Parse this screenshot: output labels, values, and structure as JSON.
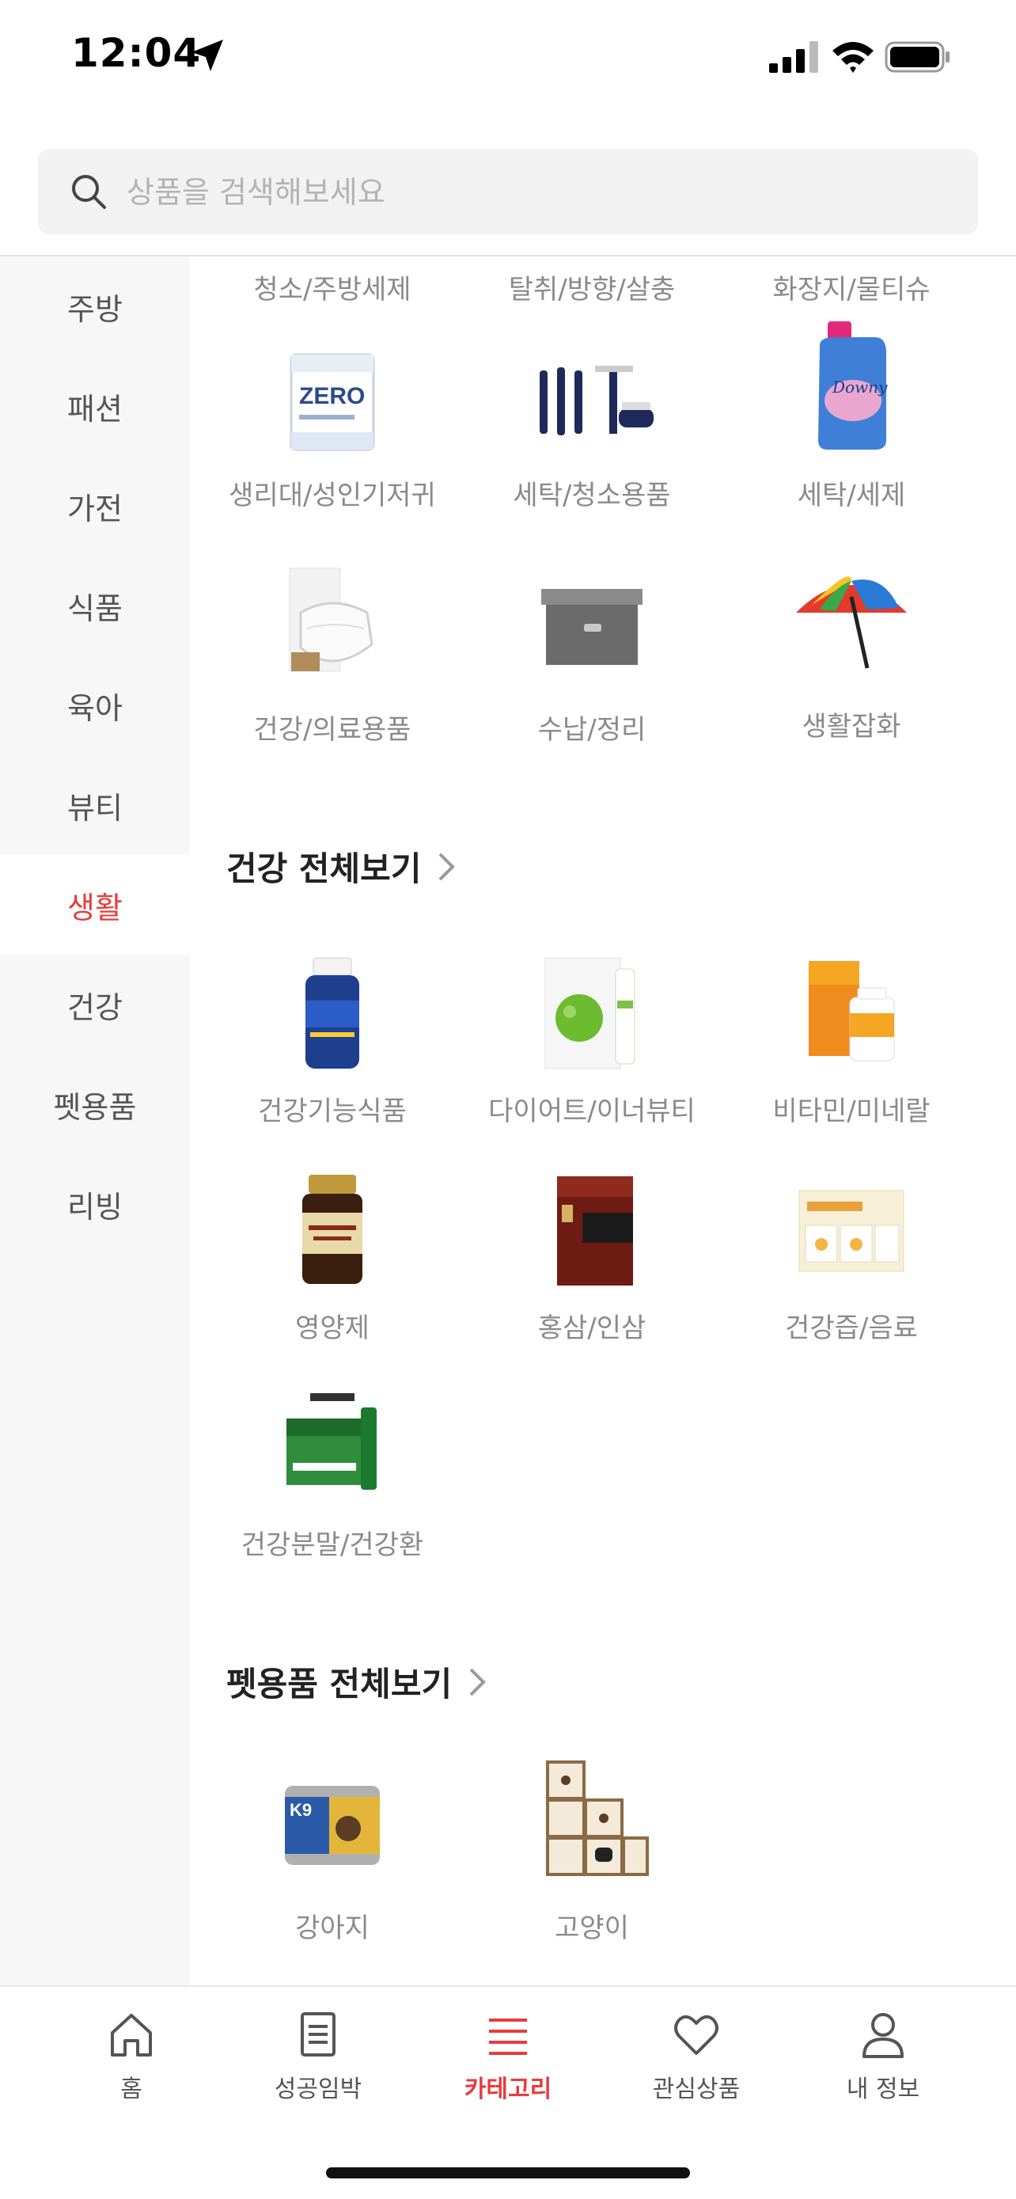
{
  "status_bar": {
    "time": "12:04"
  },
  "search": {
    "placeholder": "상품을 검색해보세요"
  },
  "sidebar": {
    "items": [
      {
        "label": "주방"
      },
      {
        "label": "패션"
      },
      {
        "label": "가전"
      },
      {
        "label": "식품"
      },
      {
        "label": "육아"
      },
      {
        "label": "뷰티"
      },
      {
        "label": "생활"
      },
      {
        "label": "건강"
      },
      {
        "label": "펫용품"
      },
      {
        "label": "리빙"
      }
    ],
    "active": "생활"
  },
  "living": {
    "top_labels": [
      "청소/주방세제",
      "탈취/방향/살충",
      "화장지/물티슈"
    ],
    "items": [
      {
        "label": "생리대/성인기저귀",
        "icon": "diaper-pack-icon"
      },
      {
        "label": "세탁/청소용품",
        "icon": "cleaning-brushes-icon"
      },
      {
        "label": "세탁/세제",
        "icon": "detergent-bottle-icon"
      },
      {
        "label": "건강/의료용품",
        "icon": "face-mask-icon"
      },
      {
        "label": "수납/정리",
        "icon": "storage-box-icon"
      },
      {
        "label": "생활잡화",
        "icon": "umbrella-icon"
      }
    ]
  },
  "health": {
    "title": "건강 전체보기",
    "items": [
      {
        "label": "건강기능식품",
        "icon": "supplement-bottle-icon"
      },
      {
        "label": "다이어트/이너뷰티",
        "icon": "apple-product-icon"
      },
      {
        "label": "비타민/미네랄",
        "icon": "vitamin-box-icon"
      },
      {
        "label": "영양제",
        "icon": "folic-acid-bottle-icon"
      },
      {
        "label": "홍삼/인삼",
        "icon": "red-ginseng-box-icon"
      },
      {
        "label": "건강즙/음료",
        "icon": "juice-box-icon"
      },
      {
        "label": "건강분말/건강환",
        "icon": "powder-stick-box-icon"
      }
    ]
  },
  "pet": {
    "title": "펫용품 전체보기",
    "items": [
      {
        "label": "강아지",
        "icon": "dog-food-can-icon"
      },
      {
        "label": "고양이",
        "icon": "cat-tower-icon"
      }
    ]
  },
  "tabbar": {
    "items": [
      {
        "label": "홈",
        "icon": "home-icon"
      },
      {
        "label": "성공임박",
        "icon": "document-icon"
      },
      {
        "label": "카테고리",
        "icon": "menu-icon"
      },
      {
        "label": "관심상품",
        "icon": "heart-icon"
      },
      {
        "label": "내 정보",
        "icon": "user-icon"
      }
    ],
    "active": "카테고리",
    "accent_color": "#e83c3c"
  }
}
